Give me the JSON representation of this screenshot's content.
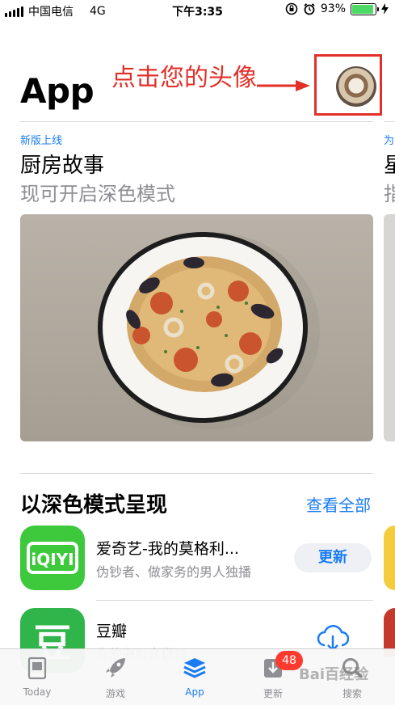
{
  "status_bar": {
    "carrier": "中国电信",
    "network": "4G",
    "time": "下午3:35",
    "battery_percent": "93%",
    "battery_level": 0.93
  },
  "header": {
    "title": "App",
    "annotation": "点击您的头像",
    "avatar_icon": "user-avatar"
  },
  "featured": {
    "tag": "新版上线",
    "title": "厨房故事",
    "subtitle": "现可开启深色模式",
    "peek_tag": "为",
    "peek_title": "星",
    "peek_subtitle": "指"
  },
  "section": {
    "title": "以深色模式呈现",
    "see_all": "查看全部"
  },
  "apps": [
    {
      "name": "爱奇艺-我的莫格利...",
      "description": "伪钞者、做家务的男人独播",
      "action": "更新",
      "icon_text": "iQIYI",
      "icon_color": "#3ec93c"
    },
    {
      "name": "豆瓣",
      "description": "你的书影音世界",
      "action_icon": "cloud-download-icon",
      "icon_text": "豆",
      "icon_color": "#2fb54a"
    }
  ],
  "tabbar": {
    "items": [
      {
        "label": "Today",
        "icon": "today-icon"
      },
      {
        "label": "游戏",
        "icon": "rocket-icon"
      },
      {
        "label": "App",
        "icon": "layers-icon"
      },
      {
        "label": "更新",
        "icon": "download-icon",
        "badge": "48"
      },
      {
        "label": "搜索",
        "icon": "search-icon"
      }
    ],
    "active_index": 2,
    "accent_color": "#1a7cf2"
  },
  "watermark": "Bai百经验"
}
